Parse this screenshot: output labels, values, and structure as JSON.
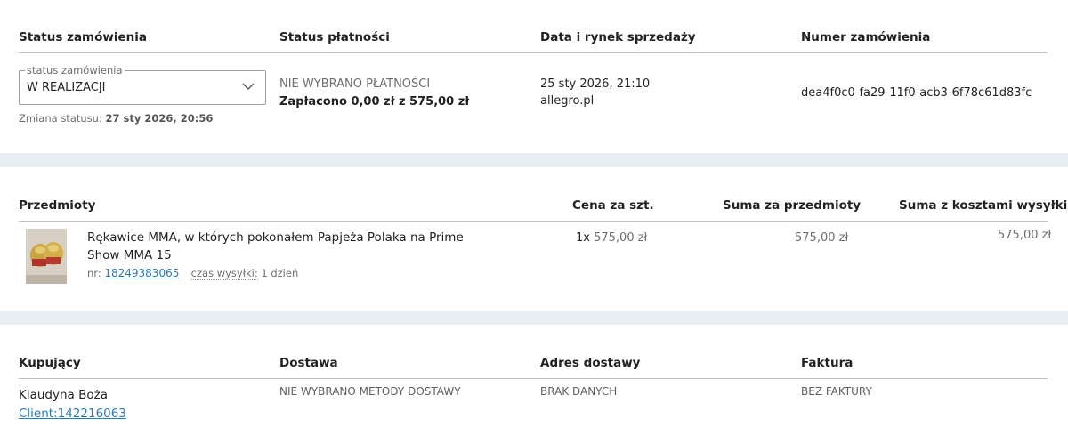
{
  "order_header": {
    "col1": "Status zamówienia",
    "col2": "Status płatności",
    "col3": "Data i rynek sprzedaży",
    "col4": "Numer zamówienia"
  },
  "order_status": {
    "legend": "status zamówienia",
    "value": "W REALIZACJI",
    "change_label": "Zmiana statusu:",
    "change_date": "27 sty 2026, 20:56"
  },
  "payment": {
    "status": "NIE WYBRANO PŁATNOŚCI",
    "paid": "Zapłacono 0,00 zł z 575,00 zł"
  },
  "sale": {
    "date": "25 sty 2026, 21:10",
    "market": "allegro.pl"
  },
  "order_number": "dea4f0c0-fa29-11f0-acb3-6f78c61d83fc",
  "items_header": {
    "col1": "Przedmioty",
    "col2": "Cena za szt.",
    "col3": "Suma za przedmioty",
    "col4": "Suma z kosztami wysyłki"
  },
  "items": [
    {
      "title_line1": "Rękawice MMA, w których pokonałem Papjeża Polaka na Prime",
      "title_line2": "Show MMA 15",
      "nr_label": "nr:",
      "nr": "18249383065",
      "shipping_label": "czas wysyłki:",
      "shipping_time": "1 dzień",
      "qty": "1x",
      "unit_price": "575,00 zł",
      "sum": "575,00 zł",
      "sum_shipping": "575,00 zł"
    }
  ],
  "buyer_header": {
    "col1": "Kupujący",
    "col2": "Dostawa",
    "col3": "Adres dostawy",
    "col4": "Faktura"
  },
  "buyer": {
    "name": "Klaudyna Boża",
    "client_link": "Client:142216063"
  },
  "delivery": "NIE WYBRANO METODY DOSTAWY",
  "address": "BRAK DANYCH",
  "invoice": "BEZ FAKTURY",
  "colors": {
    "band": "#e9eef3",
    "link": "#2a7ab8"
  }
}
